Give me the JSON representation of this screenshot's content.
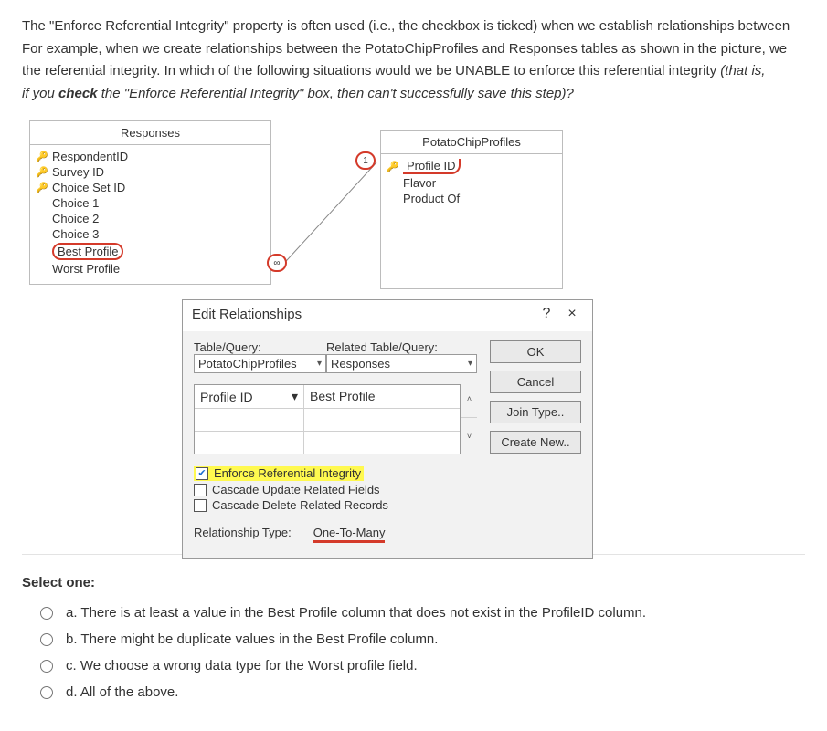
{
  "question": {
    "p1": "The \"Enforce Referential Integrity\" property is often used (i.e., the checkbox is ticked) when we establish relationships between",
    "p2": "For example, when we create relationships between the PotatoChipProfiles and Responses tables as shown in the picture, we",
    "p3a": "the referential integrity. In which of the following situations would we be UNABLE to enforce this referential integrity ",
    "p3b": "(that is,",
    "p4a": "if you ",
    "p4b": "check",
    "p4c": " the \"Enforce Referential Integrity\" box, then can't successfully save this step)?"
  },
  "tables": {
    "responses": {
      "title": "Responses",
      "fields": [
        {
          "key": true,
          "label": "RespondentID"
        },
        {
          "key": true,
          "label": "Survey ID"
        },
        {
          "key": true,
          "label": "Choice Set ID"
        },
        {
          "key": false,
          "label": "Choice 1"
        },
        {
          "key": false,
          "label": "Choice 2"
        },
        {
          "key": false,
          "label": "Choice 3"
        },
        {
          "key": false,
          "label": "Best Profile",
          "circled": true
        },
        {
          "key": false,
          "label": "Worst Profile"
        }
      ]
    },
    "potato": {
      "title": "PotatoChipProfiles",
      "fields": [
        {
          "key": true,
          "label": "Profile ID",
          "circled": true
        },
        {
          "key": false,
          "label": "Flavor"
        },
        {
          "key": false,
          "label": "Product Of"
        }
      ]
    }
  },
  "rel_badges": {
    "one": "1",
    "many": "∞"
  },
  "dialog": {
    "title": "Edit Relationships",
    "help": "?",
    "close": "×",
    "labels": {
      "table_query": "Table/Query:",
      "related_table_query": "Related Table/Query:"
    },
    "combo_left": "PotatoChipProfiles",
    "combo_right": "Responses",
    "grid_left": "Profile ID",
    "grid_right": "Best Profile",
    "buttons": {
      "ok": "OK",
      "cancel": "Cancel",
      "join": "Join Type..",
      "create": "Create New.."
    },
    "checks": {
      "eri": "Enforce Referential Integrity",
      "cuf": "Cascade Update Related Fields",
      "cdr": "Cascade Delete Related Records"
    },
    "rel_type_label": "Relationship Type:",
    "rel_type_value": "One-To-Many"
  },
  "answers": {
    "prompt": "Select one:",
    "options": [
      "a. There is at least a value in the Best Profile column that does not exist in the ProfileID column.",
      "b. There might be duplicate values in the Best Profile column.",
      "c. We choose a wrong data type for the Worst profile field.",
      "d. All of the above."
    ]
  }
}
